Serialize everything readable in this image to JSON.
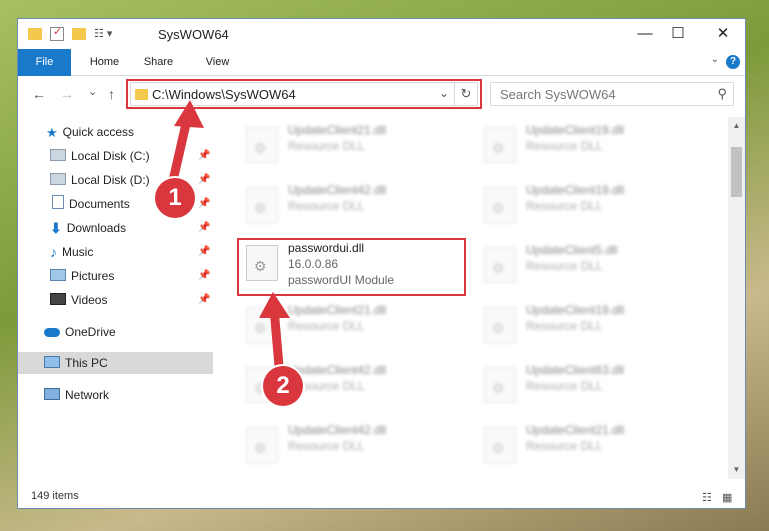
{
  "window": {
    "title": "SysWOW64",
    "minimize": "—",
    "maximize": "☐",
    "close": "✕"
  },
  "ribbon": {
    "tabs": [
      "File",
      "Home",
      "Share",
      "View"
    ],
    "help": "?"
  },
  "nav": {
    "back": "←",
    "forward": "→",
    "recent": "⌄",
    "up": "↑",
    "address": "C:\\Windows\\SysWOW64",
    "refresh": "↻",
    "search_placeholder": "Search SysWOW64"
  },
  "sidebar": {
    "items": [
      {
        "label": "Quick access",
        "icon": "star-icon"
      },
      {
        "label": "Local Disk (C:)",
        "icon": "drive-icon",
        "pinned": true
      },
      {
        "label": "Local Disk (D:)",
        "icon": "drive-icon",
        "pinned": true
      },
      {
        "label": "Documents",
        "icon": "documents-icon",
        "pinned": true
      },
      {
        "label": "Downloads",
        "icon": "downloads-icon",
        "pinned": true
      },
      {
        "label": "Music",
        "icon": "music-icon",
        "pinned": true
      },
      {
        "label": "Pictures",
        "icon": "pictures-icon",
        "pinned": true
      },
      {
        "label": "Videos",
        "icon": "videos-icon",
        "pinned": true
      },
      {
        "label": "OneDrive",
        "icon": "onedrive-icon"
      },
      {
        "label": "This PC",
        "icon": "computer-icon",
        "selected": true
      },
      {
        "label": "Network",
        "icon": "network-icon"
      }
    ]
  },
  "files": {
    "left": [
      {
        "name": "UpdateClient21.dll",
        "type": "Resource DLL"
      },
      {
        "name": "UpdateClient42.dll",
        "type": "Resource DLL"
      },
      {
        "name": "passwordui.dll",
        "version": "16.0.0.86",
        "type": "passwordUI Module"
      },
      {
        "name": "UpdateClient21.dll",
        "type": "Resource DLL"
      },
      {
        "name": "UpdateClient42.dll",
        "type": "Resource DLL"
      },
      {
        "name": "UpdateClient42.dll",
        "type": "Resource DLL"
      }
    ],
    "right": [
      {
        "name": "UpdateClient19.dll",
        "type": "Resource DLL"
      },
      {
        "name": "UpdateClient19.dll",
        "type": "Resource DLL"
      },
      {
        "name": "UpdateClient5.dll",
        "type": "Resource DLL"
      },
      {
        "name": "UpdateClient19.dll",
        "type": "Resource DLL"
      },
      {
        "name": "UpdateClient63.dll",
        "type": "Resource DLL"
      },
      {
        "name": "UpdateClient21.dll",
        "type": "Resource DLL"
      }
    ]
  },
  "status": {
    "count": "149 items"
  },
  "annotations": {
    "marker1": "1",
    "marker2": "2",
    "color": "#d9363e"
  },
  "colors": {
    "accent": "#1979ca",
    "highlight": "#d9363e",
    "folder": "#f4c84c"
  }
}
